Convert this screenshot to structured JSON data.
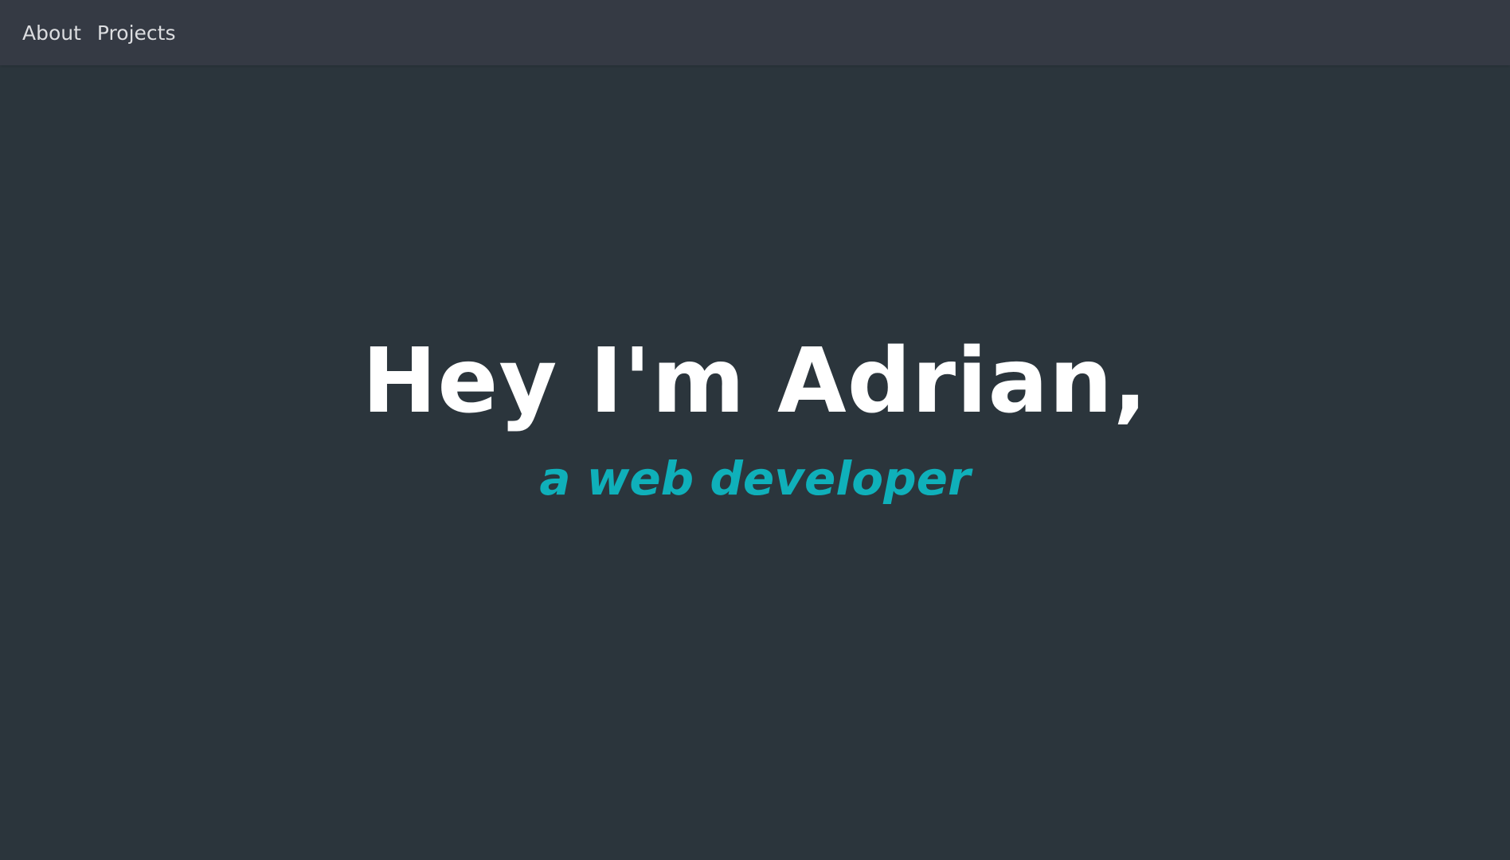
{
  "nav": {
    "items": [
      {
        "label": "About"
      },
      {
        "label": "Projects"
      }
    ]
  },
  "hero": {
    "title": "Hey I'm Adrian,",
    "subtitle": "a web developer"
  },
  "colors": {
    "background": "#2b353c",
    "navbar": "#353a44",
    "nav_text": "#dcdde0",
    "title": "#ffffff",
    "accent": "#0fb0ba"
  }
}
